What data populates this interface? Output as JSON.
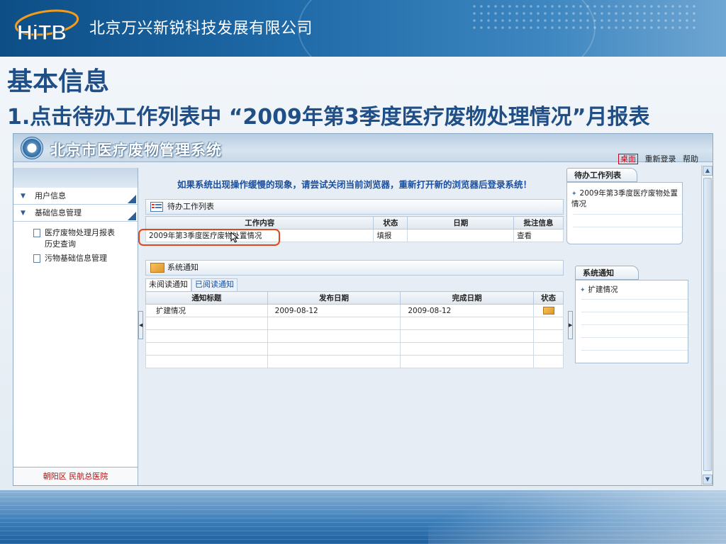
{
  "slide": {
    "logo_text": "HiTB",
    "company": "北京万兴新锐科技发展有限公司",
    "title": "基本信息",
    "subtitle": "1.点击待办工作列表中 “2009年第3季度医疗废物处理情况”月报表"
  },
  "app": {
    "title": "北京市医疗废物管理系统",
    "top_links": [
      "桌面",
      "重新登录",
      "帮助"
    ],
    "notice": "如果系统出现操作缓慢的现象，请尝试关闭当前浏览器，重新打开新的浏览器后登录系统！"
  },
  "sidebar": {
    "items": [
      {
        "label": "用户信息"
      },
      {
        "label": "基础信息管理"
      }
    ],
    "subitems": [
      {
        "label": "医疗废物处理月报表历史查询"
      },
      {
        "label": "污物基础信息管理"
      }
    ],
    "footer": "朝阳区  民航总医院"
  },
  "todo": {
    "panel_title": "待办工作列表",
    "columns": [
      "工作内容",
      "状态",
      "日期",
      "批注信息"
    ],
    "rows": [
      {
        "content": "2009年第3季度医疗废物处置情况",
        "status": "填报",
        "date": "",
        "note": "查看"
      }
    ]
  },
  "notifications": {
    "panel_title": "系统通知",
    "tabs": [
      "未阅读通知",
      "已阅读通知"
    ],
    "columns": [
      "通知标题",
      "发布日期",
      "完成日期",
      "状态"
    ],
    "rows": [
      {
        "title": "扩建情况",
        "publish": "2009-08-12",
        "complete": "2009-08-12",
        "status_icon": "envelope-icon"
      }
    ]
  },
  "right_todo": {
    "title": "待办工作列表",
    "item": "2009年第3季度医疗废物处置情况"
  },
  "right_notice": {
    "title": "系统通知",
    "item": "扩建情况"
  },
  "colors": {
    "accent": "#1f4f86",
    "highlight": "#e2461c",
    "notice": "#1b4fa0"
  }
}
